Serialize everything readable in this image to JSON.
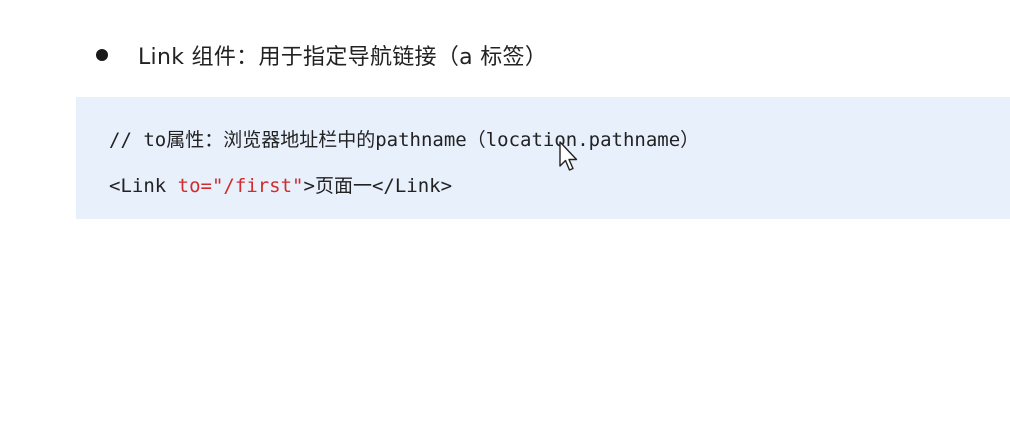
{
  "heading": {
    "text": "Link 组件：用于指定导航链接（a 标签）"
  },
  "code": {
    "comment_line": "// to属性：浏览器地址栏中的pathname（location.pathname）",
    "line2": {
      "open_tag": "<Link ",
      "attr_eq": "to=",
      "attr_value": "\"/first\"",
      "tag_close": ">",
      "content": "页面一",
      "close_tag": "</Link>"
    },
    "colors": {
      "background": "#e8f0fc",
      "string": "#d12b2b",
      "text": "#222222"
    }
  },
  "cursor": {
    "icon": "mouse-pointer-icon"
  }
}
